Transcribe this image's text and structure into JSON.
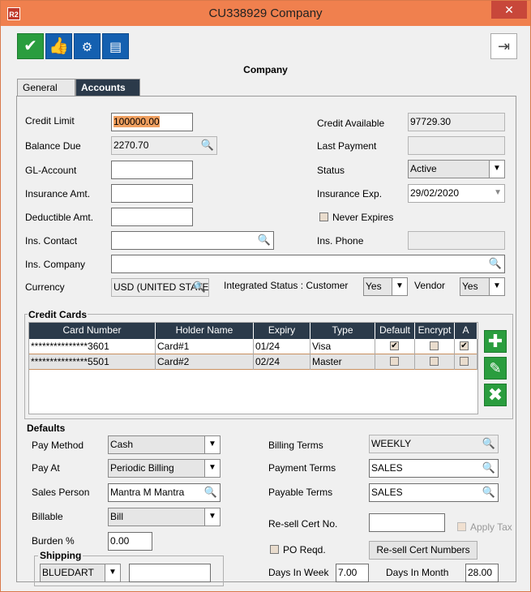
{
  "window": {
    "app_icon": "R2",
    "title": "CU338929 Company",
    "close": "✕"
  },
  "toolbar": {
    "save_icon": "check-icon",
    "approve_icon": "thumbs-up-icon",
    "view_icon": "view-icon",
    "comment_icon": "comment-icon",
    "exit_icon": "exit-icon"
  },
  "form_title": "Company",
  "tabs": [
    {
      "label": "General"
    },
    {
      "label": "Accounts"
    }
  ],
  "fields": {
    "credit_limit": {
      "label": "Credit Limit",
      "value": "100000.00"
    },
    "balance_due": {
      "label": "Balance Due",
      "value": "2270.70"
    },
    "gl_account": {
      "label": "GL-Account",
      "value": ""
    },
    "insurance_amt": {
      "label": "Insurance Amt.",
      "value": ""
    },
    "deductible_amt": {
      "label": "Deductible Amt.",
      "value": ""
    },
    "ins_contact": {
      "label": "Ins. Contact",
      "value": ""
    },
    "ins_company": {
      "label": "Ins. Company",
      "value": ""
    },
    "currency": {
      "label": "Currency",
      "value": "USD (UNITED STATE"
    },
    "integrated_status": {
      "label": "Integrated Status : Customer",
      "value": "Yes"
    },
    "vendor": {
      "label": "Vendor",
      "value": "Yes"
    },
    "credit_available": {
      "label": "Credit Available",
      "value": "97729.30"
    },
    "last_payment": {
      "label": "Last Payment",
      "value": ""
    },
    "status": {
      "label": "Status",
      "value": "Active"
    },
    "insurance_exp": {
      "label": "Insurance Exp.",
      "value": "29/02/2020"
    },
    "never_expires": {
      "label": "Never Expires"
    },
    "ins_phone": {
      "label": "Ins. Phone",
      "value": ""
    }
  },
  "credit_cards": {
    "title": "Credit Cards",
    "columns": [
      "Card Number",
      "Holder Name",
      "Expiry",
      "Type",
      "Default",
      "Encrypt",
      "A"
    ],
    "rows": [
      {
        "card": "***************3601",
        "holder": "Card#1",
        "expiry": "01/24",
        "type": "Visa",
        "default": "✔",
        "encrypt": "",
        "a": "✔"
      },
      {
        "card": "***************5501",
        "holder": "Card#2",
        "expiry": "02/24",
        "type": "Master",
        "default": "",
        "encrypt": "",
        "a": ""
      }
    ]
  },
  "defaults": {
    "title": "Defaults",
    "pay_method": {
      "label": "Pay Method",
      "value": "Cash"
    },
    "pay_at": {
      "label": "Pay At",
      "value": "Periodic Billing"
    },
    "sales_person": {
      "label": "Sales Person",
      "value": "Mantra M Mantra"
    },
    "billable": {
      "label": "Billable",
      "value": "Bill"
    },
    "burden": {
      "label": "Burden %",
      "value": "0.00"
    },
    "shipping": {
      "title": "Shipping",
      "carrier": "BLUEDART",
      "value": ""
    },
    "billing_terms": {
      "label": "Billing Terms",
      "value": "WEEKLY"
    },
    "payment_terms": {
      "label": "Payment Terms",
      "value": "SALES"
    },
    "payable_terms": {
      "label": "Payable Terms",
      "value": "SALES"
    },
    "resell_cert": {
      "label": "Re-sell Cert No.",
      "value": ""
    },
    "apply_tax": {
      "label": "Apply Tax"
    },
    "po_reqd": {
      "label": "PO Reqd."
    },
    "resell_button": "Re-sell Cert Numbers",
    "days_in_week": {
      "label": "Days In Week",
      "value": "7.00"
    },
    "days_in_month": {
      "label": "Days In Month",
      "value": "28.00"
    }
  }
}
